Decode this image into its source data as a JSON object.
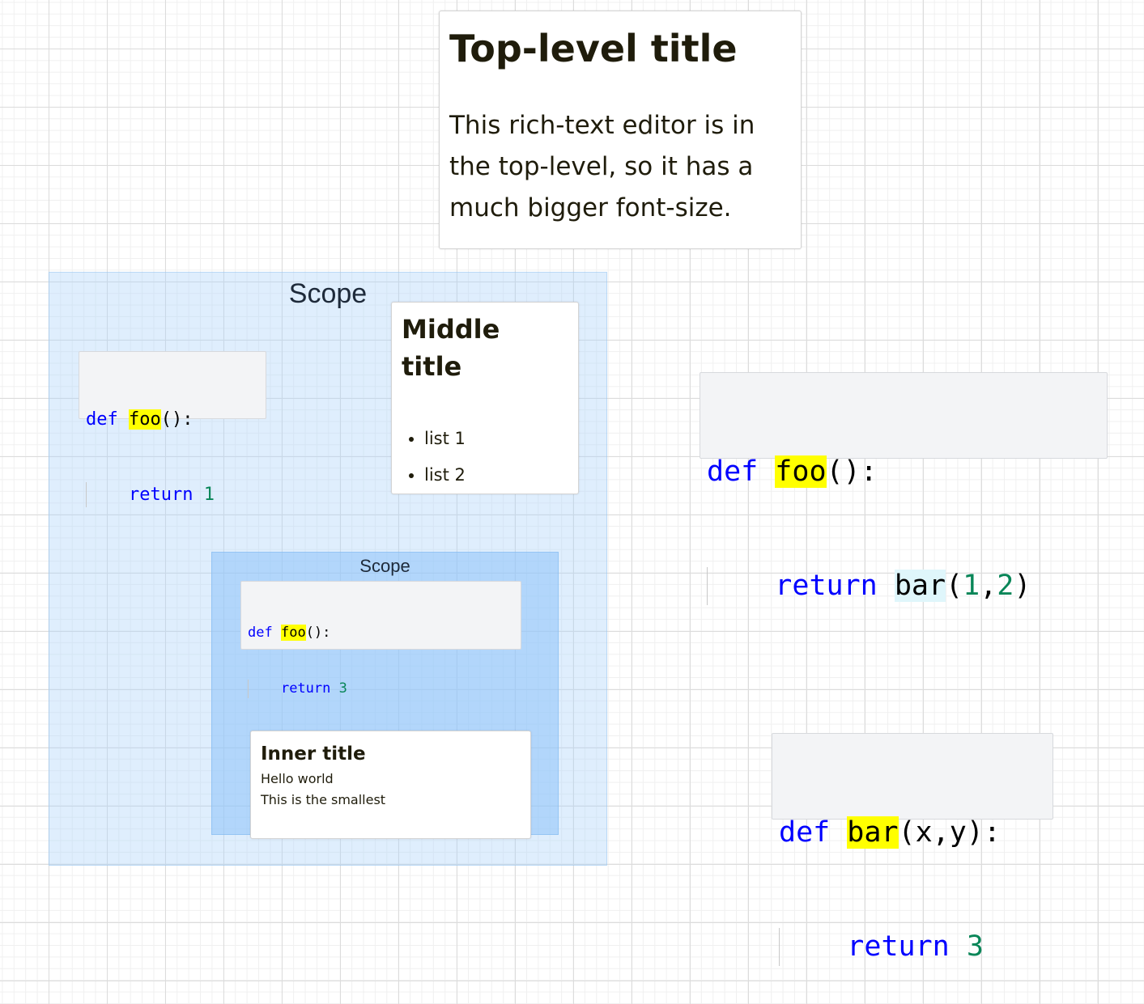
{
  "top_card": {
    "title": "Top-level title",
    "body": "This rich-text editor is in the top-level, so it has a much bigger font-size."
  },
  "outer_scope": {
    "label": "Scope",
    "code": {
      "kw_def": "def",
      "fn_name": "foo",
      "sig_rest": "():",
      "kw_return": "return",
      "value": "1"
    },
    "middle_card": {
      "title": "Middle title",
      "items": [
        "list 1",
        "list 2"
      ]
    },
    "inner_scope": {
      "label": "Scope",
      "code": {
        "kw_def": "def",
        "fn_name": "foo",
        "sig_rest": "():",
        "kw_return": "return",
        "value": "3"
      },
      "inner_card": {
        "title": "Inner title",
        "line1": "Hello world",
        "line2": "This is the smallest"
      }
    }
  },
  "code_right_1": {
    "kw_def": "def",
    "fn_name": "foo",
    "sig_rest": "():",
    "kw_return": "return",
    "call_name": "bar",
    "open": "(",
    "arg1": "1",
    "comma": ",",
    "arg2": "2",
    "close": ")"
  },
  "code_right_2": {
    "kw_def": "def",
    "fn_name": "bar",
    "sig_rest": "(x,y):",
    "kw_return": "return",
    "value": "3"
  },
  "colors": {
    "keyword": "#0000ff",
    "number": "#098658",
    "highlight": "#ffff00",
    "heading_text": "#1f1c0b"
  }
}
